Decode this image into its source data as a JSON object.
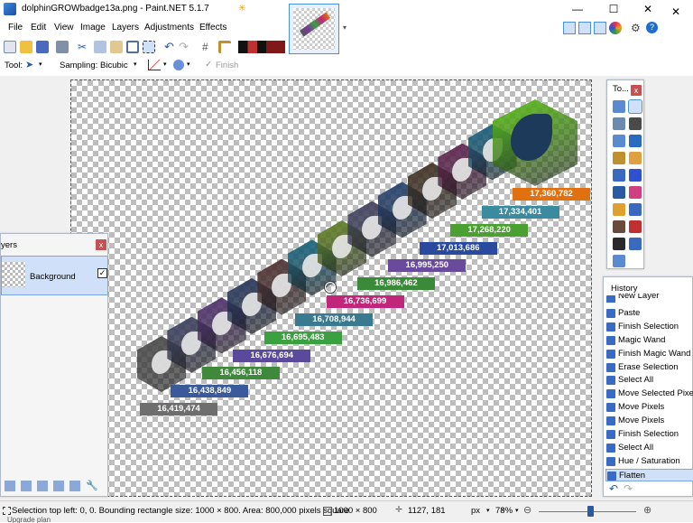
{
  "window": {
    "title": "dolphinGROWbadge13a.png - Paint.NET 5.1.7",
    "minimize": "—",
    "maximize": "☐",
    "close": "✕"
  },
  "menu": {
    "items": [
      "File",
      "Edit",
      "View",
      "Image",
      "Layers",
      "Adjustments",
      "Effects"
    ]
  },
  "toolbar2": {
    "tool_label": "Tool:",
    "sampling_label": "Sampling:",
    "sampling_value": "Bicubic",
    "finish_label": "Finish"
  },
  "badges": [
    {
      "value": "16,419,474",
      "color": "#6e6e6e",
      "hex": "#555555"
    },
    {
      "value": "16,438,849",
      "color": "#3a5a9c",
      "hex": "#444a6a"
    },
    {
      "value": "16,456,118",
      "color": "#3f8a3a",
      "hex": "#5a3a7a"
    },
    {
      "value": "16,676,694",
      "color": "#5a4a9c",
      "hex": "#2e3f66"
    },
    {
      "value": "16,695,483",
      "color": "#3aa040",
      "hex": "#5a3a3a"
    },
    {
      "value": "16,708,944",
      "color": "#3a7a90",
      "hex": "#1e6e8a"
    },
    {
      "value": "16,736,699",
      "color": "#c0267a",
      "hex": "#6a8a2a"
    },
    {
      "value": "16,986,462",
      "color": "#3a8a3a",
      "hex": "#4a4a6a"
    },
    {
      "value": "16,995,250",
      "color": "#6a4a9c",
      "hex": "#2a4a7a"
    },
    {
      "value": "17,013,686",
      "color": "#2a4aa0",
      "hex": "#4a3a2a"
    },
    {
      "value": "17,268,220",
      "color": "#4aa030",
      "hex": "#6a2a5a"
    },
    {
      "value": "17,334,401",
      "color": "#3a8aa0",
      "hex": "#1e6a8a"
    },
    {
      "value": "17,360,782",
      "color": "#e07010",
      "hex": "#60c020"
    }
  ],
  "layers": {
    "title": "yers",
    "item": "Background"
  },
  "tools_panel": {
    "title": "To..."
  },
  "history": {
    "title": "History",
    "items": [
      "New Layer",
      "Paste",
      "Finish Selection",
      "Magic Wand",
      "Finish Magic Wand",
      "Erase Selection",
      "Select All",
      "Move Selected Pixels",
      "Move Pixels",
      "Move Pixels",
      "Finish Selection",
      "Select All",
      "Hue / Saturation",
      "Flatten"
    ]
  },
  "status": {
    "selection": "Selection top left: 0, 0. Bounding rectangle size: 1000 × 800. Area: 800,000 pixels square",
    "image_size": "1000 × 800",
    "cursor": "1127, 181",
    "unit": "px",
    "zoom": "78%",
    "upgrade": "Upgrade plan"
  }
}
